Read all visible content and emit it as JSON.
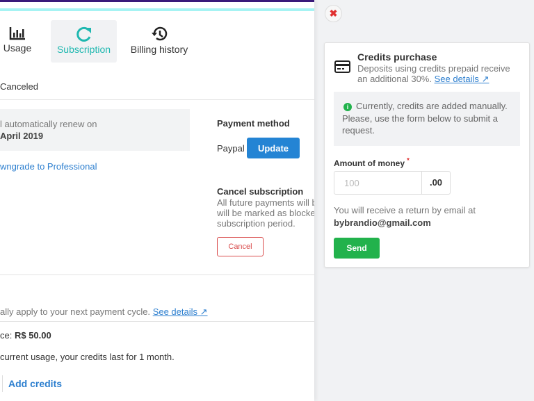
{
  "tabs": [
    {
      "label": "Usage",
      "icon": "bar-chart-icon"
    },
    {
      "label": "Subscription",
      "icon": "refresh-icon",
      "active": true
    },
    {
      "label": "Billing history",
      "icon": "history-icon"
    }
  ],
  "status": "Canceled",
  "renewal": {
    "text": "l automatically renew on",
    "date": "April 2019"
  },
  "downgrade_link": "wngrade to Professional",
  "payment": {
    "title": "Payment method",
    "method": "Paypal",
    "update_label": "Update"
  },
  "cancel": {
    "title": "Cancel subscription",
    "lines": [
      "All future payments will b",
      "will be marked as blocke",
      "subscription period."
    ],
    "button": "Cancel"
  },
  "credits_note": {
    "text": "ally apply to your next payment cycle.",
    "link": "See details"
  },
  "balance": {
    "label": "ce:",
    "value": "R$ 50.00"
  },
  "usage_text": "current usage, your credits last for 1 month.",
  "add_credits": "Add credits",
  "panel": {
    "close_icon": "close-icon",
    "title": "Credits purchase",
    "desc1": "Deposits using credits prepaid receive",
    "desc2": "an additional 30%.",
    "link": "See details",
    "info": "Currently, credits are added manually. Please, use the form below to submit a request.",
    "amount_label": "Amount of money",
    "required": "*",
    "amount_placeholder": "100",
    "amount_suffix": ".00",
    "email_text": "You will receive a return by email at",
    "email": "bybrandio@gmail.com",
    "send": "Send"
  },
  "colors": {
    "accent": "#1fb8b0",
    "primary": "#2484d4",
    "danger": "#d94b4b",
    "success": "#22b24c"
  }
}
